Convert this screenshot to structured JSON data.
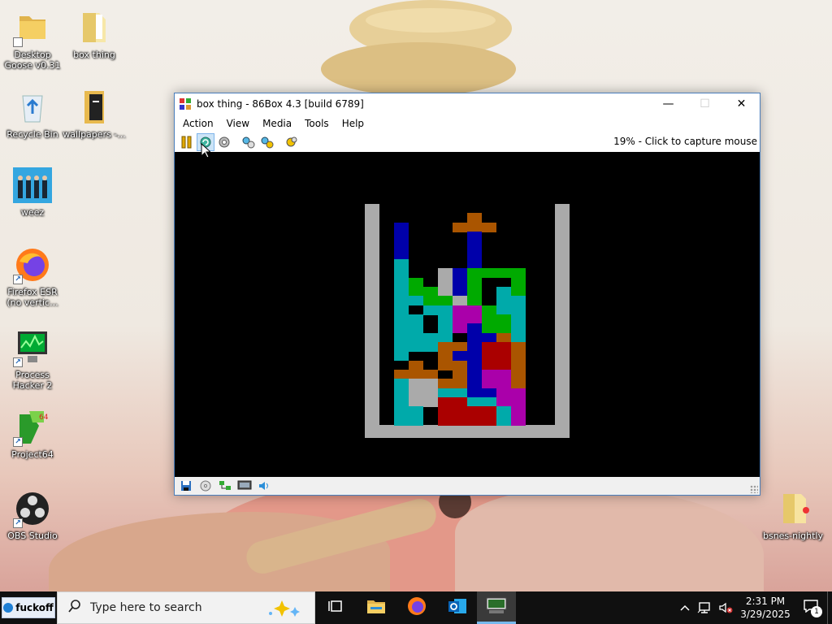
{
  "desktop": {
    "icons": [
      {
        "id": "desktop-goose",
        "label": "Desktop Goose v0.31"
      },
      {
        "id": "box-thing",
        "label": "box thing"
      },
      {
        "id": "recycle-bin",
        "label": "Recycle Bin"
      },
      {
        "id": "wallpapers",
        "label": "wallpapers -..."
      },
      {
        "id": "weez",
        "label": "weez"
      },
      {
        "id": "firefox-esr",
        "label": "Firefox ESR (no vertic..."
      },
      {
        "id": "process-hacker",
        "label": "Process Hacker 2"
      },
      {
        "id": "project64",
        "label": "Project64"
      },
      {
        "id": "obs-studio",
        "label": "OBS Studio"
      },
      {
        "id": "bsnes-nightly",
        "label": "bsnes-nightly"
      }
    ]
  },
  "window": {
    "title": "box thing - 86Box 4.3 [build 6789]",
    "controls": {
      "minimize": "—",
      "maximize": "☐",
      "close": "✕"
    },
    "menu": [
      "Action",
      "View",
      "Media",
      "Tools",
      "Help"
    ],
    "toolbar": {
      "buttons": [
        "pause-icon",
        "reset-icon",
        "ctrl-alt-del-icon",
        "settings-icon",
        "hard-reset-icon",
        "screenshot-icon"
      ],
      "status": "19% - Click to capture mouse"
    },
    "statusbar": [
      "floppy-icon",
      "cdrom-icon",
      "network-icon",
      "display-icon",
      "sound-icon"
    ]
  },
  "game": {
    "colors": {
      "Y": "#aaaaaa",
      "B": "#0000aa",
      "C": "#00aaaa",
      "G": "#00aa00",
      "M": "#aa00aa",
      "O": "#aa5500",
      "R": "#aa0000",
      "W": "#aaaaaa"
    },
    "board": [
      "..........",
      "......O...",
      ".B...OOO..",
      ".B....B...",
      ".B....B...",
      ".B....B...",
      ".C....B...",
      ".C..WBGGGG",
      ".CG.WBG..G",
      ".CGGWBG.CG",
      ".CCGGWG.CC",
      ".C.CCMMGCC",
      ".CC.CMMGGC",
      ".CC.CMBGGC",
      ".CCCC.BBOC",
      ".CCCOOBRRO",
      ".C..OBBRRO",
      "..O.OOBRRO",
      ".OOO.OBMMO",
      ".CWWOOBMMO",
      ".CWWCCBBMM",
      ".CWWRRCCMM",
      ".CC.RRRRCM",
      ".CC.RRRRCM"
    ]
  },
  "taskbar": {
    "start_label": "fuckoff",
    "search_placeholder": "Type here to search",
    "apps": [
      "task-view-icon",
      "file-explorer-icon",
      "firefox-icon",
      "outlook-icon",
      "86box-icon"
    ],
    "time": "2:31 PM",
    "date": "3/29/2025",
    "notifications_count": "1"
  }
}
